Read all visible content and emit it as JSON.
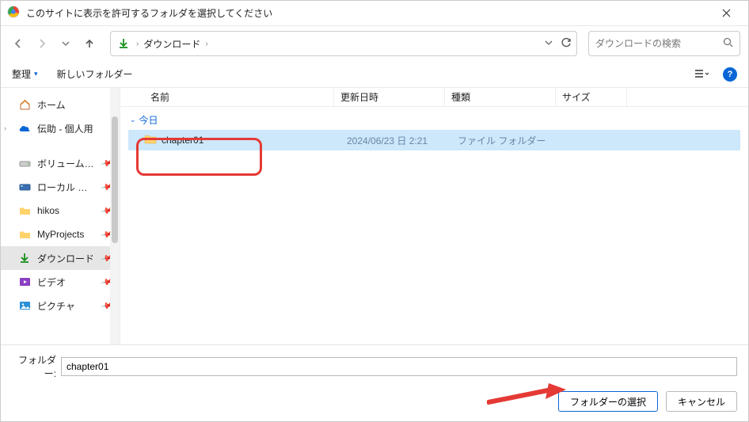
{
  "title": "このサイトに表示を許可するフォルダを選択してください",
  "breadcrumb": {
    "label": "ダウンロード"
  },
  "search": {
    "placeholder": "ダウンロードの検索"
  },
  "toolbar": {
    "organize": "整理",
    "newfolder": "新しいフォルダー"
  },
  "columns": {
    "name": "名前",
    "date": "更新日時",
    "type": "種類",
    "size": "サイズ"
  },
  "group": {
    "today": "今日"
  },
  "sidebar": {
    "home": "ホーム",
    "personal": "伝助 - 個人用",
    "volumeD": "ボリューム (D:)",
    "localdisk": "ローカル ディスク",
    "hikos": "hikos",
    "myprojects": "MyProjects",
    "downloads": "ダウンロード",
    "videos": "ビデオ",
    "pictures": "ピクチャ"
  },
  "row": {
    "name": "chapter01",
    "date": "2024/06/23 日 2:21",
    "type": "ファイル フォルダー",
    "size": ""
  },
  "footer": {
    "label": "フォルダー:",
    "value": "chapter01",
    "select": "フォルダーの選択",
    "cancel": "キャンセル"
  }
}
